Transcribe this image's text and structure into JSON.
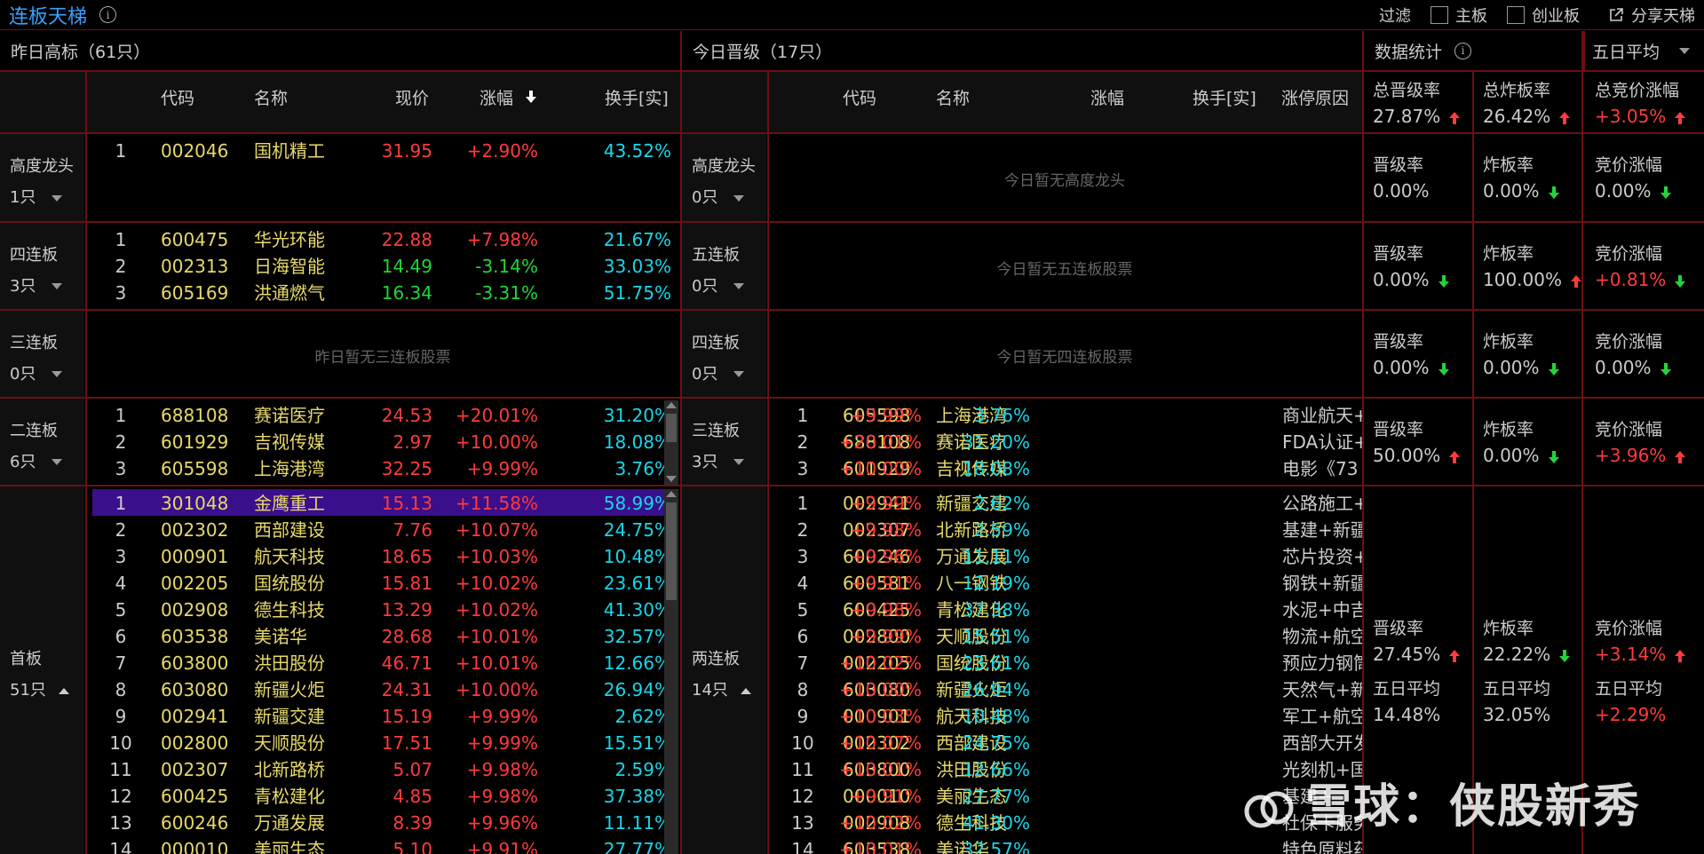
{
  "topbar": {
    "title": "连板天梯",
    "filter_label": "过滤",
    "filter_options": [
      "主板",
      "创业板"
    ],
    "share_label": "分享天梯"
  },
  "left": {
    "header": "昨日高标（61只）",
    "columns": [
      "代码",
      "名称",
      "现价",
      "涨幅",
      "换手[实]"
    ],
    "sections": [
      {
        "label": "高度龙头",
        "count": "1只",
        "caret": "down",
        "empty": "",
        "rows": [
          [
            "1",
            "002046",
            "国机精工",
            "31.95",
            "+2.90%",
            "43.52%",
            "up"
          ]
        ]
      },
      {
        "label": "四连板",
        "count": "3只",
        "caret": "down",
        "empty": "",
        "rows": [
          [
            "1",
            "600475",
            "华光环能",
            "22.88",
            "+7.98%",
            "21.67%",
            "up"
          ],
          [
            "2",
            "002313",
            "日海智能",
            "14.49",
            "-3.14%",
            "33.03%",
            "down"
          ],
          [
            "3",
            "605169",
            "洪通燃气",
            "16.34",
            "-3.31%",
            "51.75%",
            "down"
          ]
        ]
      },
      {
        "label": "三连板",
        "count": "0只",
        "caret": "down",
        "empty": "昨日暂无三连板股票",
        "rows": []
      },
      {
        "label": "二连板",
        "count": "6只",
        "caret": "down",
        "empty": "",
        "rows": [
          [
            "1",
            "688108",
            "赛诺医疗",
            "24.53",
            "+20.01%",
            "31.20%",
            "up"
          ],
          [
            "2",
            "601929",
            "吉视传媒",
            "2.97",
            "+10.00%",
            "18.08%",
            "up"
          ],
          [
            "3",
            "605598",
            "上海港湾",
            "32.25",
            "+9.99%",
            "3.76%",
            "up"
          ]
        ]
      },
      {
        "label": "首板",
        "count": "51只",
        "caret": "up",
        "empty": "",
        "rows": [
          [
            "1",
            "301048",
            "金鹰重工",
            "15.13",
            "+11.58%",
            "58.99%",
            "up"
          ],
          [
            "2",
            "002302",
            "西部建设",
            "7.76",
            "+10.07%",
            "24.75%",
            "up"
          ],
          [
            "3",
            "000901",
            "航天科技",
            "18.65",
            "+10.03%",
            "10.48%",
            "up"
          ],
          [
            "4",
            "002205",
            "国统股份",
            "15.81",
            "+10.02%",
            "23.61%",
            "up"
          ],
          [
            "5",
            "002908",
            "德生科技",
            "13.29",
            "+10.02%",
            "41.30%",
            "up"
          ],
          [
            "6",
            "603538",
            "美诺华",
            "28.68",
            "+10.01%",
            "32.57%",
            "up"
          ],
          [
            "7",
            "603800",
            "洪田股份",
            "46.71",
            "+10.01%",
            "12.66%",
            "up"
          ],
          [
            "8",
            "603080",
            "新疆火炬",
            "24.31",
            "+10.00%",
            "26.94%",
            "up"
          ],
          [
            "9",
            "002941",
            "新疆交建",
            "15.19",
            "+9.99%",
            "2.62%",
            "up"
          ],
          [
            "10",
            "002800",
            "天顺股份",
            "17.51",
            "+9.99%",
            "15.51%",
            "up"
          ],
          [
            "11",
            "002307",
            "北新路桥",
            "5.07",
            "+9.98%",
            "2.59%",
            "up"
          ],
          [
            "12",
            "600425",
            "青松建化",
            "4.85",
            "+9.98%",
            "37.38%",
            "up"
          ],
          [
            "13",
            "600246",
            "万通发展",
            "8.39",
            "+9.96%",
            "11.11%",
            "up"
          ],
          [
            "14",
            "000010",
            "美丽生态",
            "5.10",
            "+9.91%",
            "27.77%",
            "up"
          ]
        ]
      }
    ]
  },
  "mid": {
    "header": "今日晋级（17只）",
    "columns": [
      "代码",
      "名称",
      "涨幅",
      "换手[实]",
      "涨停原因"
    ],
    "sections": [
      {
        "label": "高度龙头",
        "count": "0只",
        "caret": "down",
        "empty": "今日暂无高度龙头",
        "rows": []
      },
      {
        "label": "五连板",
        "count": "0只",
        "caret": "down",
        "empty": "今日暂无五连板股票",
        "rows": []
      },
      {
        "label": "四连板",
        "count": "0只",
        "caret": "down",
        "empty": "今日暂无四连板股票",
        "rows": []
      },
      {
        "label": "三连板",
        "count": "3只",
        "caret": "down",
        "empty": "",
        "rows": [
          [
            "1",
            "605598",
            "上海港湾",
            "+9.99%",
            "3.76%",
            "商业航天+"
          ],
          [
            "2",
            "688108",
            "赛诺医疗",
            "+20.01%",
            "31.20%",
            "FDA认证+"
          ],
          [
            "3",
            "601929",
            "吉视传媒",
            "+10.00%",
            "18.08%",
            "电影《73"
          ]
        ]
      },
      {
        "label": "两连板",
        "count": "14只",
        "caret": "up",
        "empty": "",
        "rows": [
          [
            "1",
            "002941",
            "新疆交建",
            "+9.99%",
            "2.62%",
            "公路施工+"
          ],
          [
            "2",
            "002307",
            "北新路桥",
            "+9.98%",
            "2.59%",
            "基建+新疆"
          ],
          [
            "3",
            "600246",
            "万通发展",
            "+9.96%",
            "11.11%",
            "芯片投资+"
          ],
          [
            "4",
            "600581",
            "八一钢铁",
            "+9.91%",
            "12.19%",
            "钢铁+新疆"
          ],
          [
            "5",
            "600425",
            "青松建化",
            "+9.98%",
            "37.38%",
            "水泥+中吉"
          ],
          [
            "6",
            "002800",
            "天顺股份",
            "+9.99%",
            "15.51%",
            "物流+航空"
          ],
          [
            "7",
            "002205",
            "国统股份",
            "+10.02%",
            "23.61%",
            "预应力钢筒"
          ],
          [
            "8",
            "603080",
            "新疆火炬",
            "+10.00%",
            "26.94%",
            "天然气+新"
          ],
          [
            "9",
            "000901",
            "航天科技",
            "+10.03%",
            "10.48%",
            "军工+航空"
          ],
          [
            "10",
            "002302",
            "西部建设",
            "+10.07%",
            "24.75%",
            "西部大开发"
          ],
          [
            "11",
            "603800",
            "洪田股份",
            "+10.01%",
            "12.66%",
            "光刻机+国"
          ],
          [
            "12",
            "000010",
            "美丽生态",
            "+9.91%",
            "27.77%",
            "基建+"
          ],
          [
            "13",
            "002908",
            "德生科技",
            "+10.02%",
            "41.30%",
            "社保卡服务"
          ],
          [
            "14",
            "603538",
            "美诺华",
            "+10.01%",
            "32.57%",
            "特色原料药"
          ]
        ]
      }
    ]
  },
  "stats": {
    "header": "数据统计",
    "dropdown": "五日平均",
    "summary": [
      {
        "title": "总晋级率",
        "value": "27.87%",
        "trend": "up",
        "color": "normal"
      },
      {
        "title": "总炸板率",
        "value": "26.42%",
        "trend": "up",
        "color": "normal"
      },
      {
        "title": "总竞价涨幅",
        "value": "+3.05%",
        "trend": "up",
        "color": "up"
      }
    ],
    "rows": [
      [
        {
          "title": "晋级率",
          "value": "0.00%",
          "trend": "",
          "color": "normal"
        },
        {
          "title": "炸板率",
          "value": "0.00%",
          "trend": "down",
          "color": "normal"
        },
        {
          "title": "竞价涨幅",
          "value": "0.00%",
          "trend": "down",
          "color": "normal"
        }
      ],
      [
        {
          "title": "晋级率",
          "value": "0.00%",
          "trend": "down",
          "color": "normal"
        },
        {
          "title": "炸板率",
          "value": "100.00%",
          "trend": "up",
          "color": "normal"
        },
        {
          "title": "竞价涨幅",
          "value": "+0.81%",
          "trend": "down",
          "color": "up"
        }
      ],
      [
        {
          "title": "晋级率",
          "value": "0.00%",
          "trend": "down",
          "color": "normal"
        },
        {
          "title": "炸板率",
          "value": "0.00%",
          "trend": "down",
          "color": "normal"
        },
        {
          "title": "竞价涨幅",
          "value": "0.00%",
          "trend": "down",
          "color": "normal"
        }
      ],
      [
        {
          "title": "晋级率",
          "value": "50.00%",
          "trend": "up",
          "color": "normal"
        },
        {
          "title": "炸板率",
          "value": "0.00%",
          "trend": "down",
          "color": "normal"
        },
        {
          "title": "竞价涨幅",
          "value": "+3.96%",
          "trend": "up",
          "color": "up"
        }
      ],
      [
        {
          "title": "晋级率",
          "value": "27.45%",
          "trend": "up",
          "color": "normal",
          "avg_title": "五日平均",
          "avg_value": "14.48%",
          "avg_color": "normal"
        },
        {
          "title": "炸板率",
          "value": "22.22%",
          "trend": "down",
          "color": "normal",
          "avg_title": "五日平均",
          "avg_value": "32.05%",
          "avg_color": "normal"
        },
        {
          "title": "竞价涨幅",
          "value": "+3.14%",
          "trend": "up",
          "color": "up",
          "avg_title": "五日平均",
          "avg_value": "+2.29%",
          "avg_color": "up"
        }
      ]
    ]
  },
  "watermark": "雪球：侠股新秀"
}
